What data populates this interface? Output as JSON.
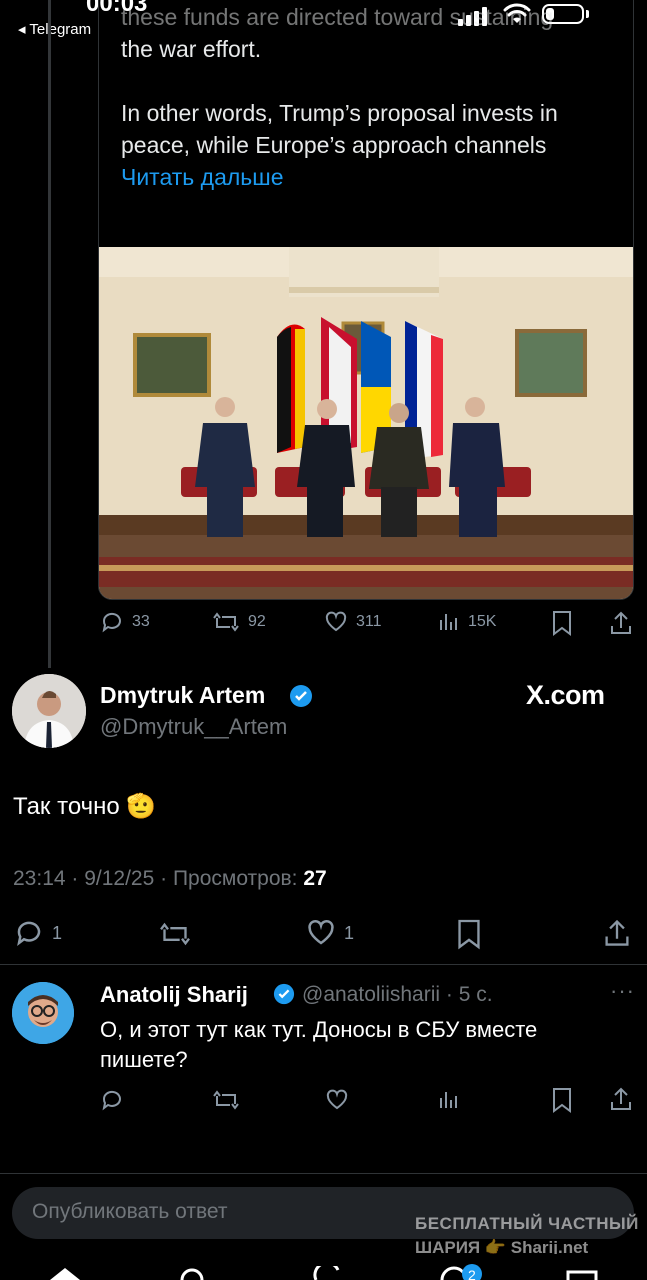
{
  "status_bar": {
    "time": "00:03",
    "back_label": "◂ Telegram"
  },
  "quote": {
    "faded_line": "these funds are directed toward sustaining",
    "text": "the war effort.\n\nIn other words, Trump’s proposal invests in peace, while Europe’s approach channels ",
    "read_more": "Читать дальше",
    "actions": {
      "replies": "33",
      "reposts": "92",
      "likes": "311",
      "views": "15K"
    }
  },
  "tweet": {
    "author_name": "Dmytruk Artem",
    "handle": "@Dmytruk__Artem",
    "source": "X.com",
    "body": "Так точно 🫡",
    "meta_prefix": "23:14 · 9/12/25 · Просмотров: ",
    "views": "27",
    "actions": {
      "replies": "1",
      "likes": "1"
    }
  },
  "reply": {
    "author_name": "Anatolij Sharij",
    "handle_time": "@anatoliisharii · 5 с.",
    "more": "···",
    "body": "О, и этот тут как тут. Доносы в СБУ вместе пишете?"
  },
  "composer": {
    "placeholder": "Опубликовать ответ"
  },
  "watermark": {
    "line1": "БЕСПЛАТНЫЙ ЧАСТНЫЙ",
    "line2": "ШАРИЯ 👉 Sharij.net"
  },
  "colors": {
    "accent": "#1d9bf0",
    "background": "#000000",
    "muted": "#71767b"
  }
}
